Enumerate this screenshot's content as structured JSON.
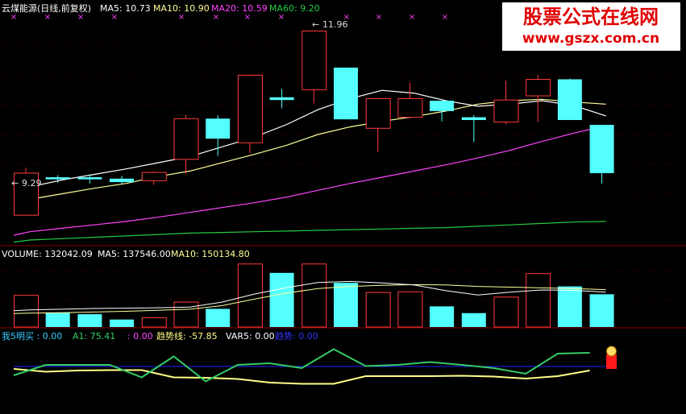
{
  "colors": {
    "up": "#ff3b3b",
    "down": "#54ffff",
    "ma5": "#ffffff",
    "ma10": "#ffff9a",
    "ma20": "#ff44ff",
    "ma60": "#22cc44",
    "divider": "#8a0000",
    "grid": "#4a0000",
    "axis_line": "#2222ff",
    "green_line": "#33cc66",
    "yellow_line": "#ffff88"
  },
  "main": {
    "title": "云煤能源(日线,前复权)",
    "ma5_label": "MA5: 10.73",
    "ma10_label": "MA10: 10.90",
    "ma20_label": "MA20: 10.59",
    "ma60_label": "MA60: 9.20",
    "high_label": "11.96",
    "low_label": "9.29"
  },
  "volume": {
    "label": "VOLUME: 132042.09",
    "ma5_label": "MA5: 137546.00",
    "ma10_label": "MA10: 150134.80"
  },
  "indicator": {
    "label1": "我5明买 : 0.00",
    "label2": "A1: 75.41",
    "label3": ": 0.00",
    "label4": "趋势线: -57.85",
    "label5": "VAR5: 0.00",
    "label6": "趋势: 0.00"
  },
  "watermark": {
    "line1": "股票公式在线网",
    "line2": "www.gszx.com.cn"
  },
  "chart_data": {
    "type": "candlestick",
    "price_range": [
      9.0,
      12.2
    ],
    "candles": [
      {
        "open": 9.29,
        "close": 9.9,
        "high": 9.98,
        "low": 9.29
      },
      {
        "open": 9.84,
        "close": 9.81,
        "high": 9.87,
        "low": 9.76
      },
      {
        "open": 9.84,
        "close": 9.81,
        "high": 9.88,
        "low": 9.75
      },
      {
        "open": 9.82,
        "close": 9.77,
        "high": 9.86,
        "low": 9.74
      },
      {
        "open": 9.79,
        "close": 9.91,
        "high": 9.93,
        "low": 9.73
      },
      {
        "open": 10.1,
        "close": 10.69,
        "high": 10.74,
        "low": 9.89
      },
      {
        "open": 10.69,
        "close": 10.4,
        "high": 10.74,
        "low": 10.15
      },
      {
        "open": 10.34,
        "close": 11.32,
        "high": 11.32,
        "low": 10.19
      },
      {
        "open": 11.0,
        "close": 10.96,
        "high": 11.12,
        "low": 10.84
      },
      {
        "open": 11.11,
        "close": 11.96,
        "high": 11.96,
        "low": 10.91
      },
      {
        "open": 11.43,
        "close": 10.68,
        "high": 11.43,
        "low": 10.68
      },
      {
        "open": 10.55,
        "close": 10.98,
        "high": 10.98,
        "low": 10.21
      },
      {
        "open": 10.71,
        "close": 10.98,
        "high": 11.21,
        "low": 10.69
      },
      {
        "open": 10.95,
        "close": 10.8,
        "high": 10.95,
        "low": 10.65
      },
      {
        "open": 10.71,
        "close": 10.67,
        "high": 10.74,
        "low": 10.35
      },
      {
        "open": 10.64,
        "close": 10.96,
        "high": 11.24,
        "low": 10.61
      },
      {
        "open": 11.02,
        "close": 11.26,
        "high": 11.32,
        "low": 10.64
      },
      {
        "open": 11.26,
        "close": 10.67,
        "high": 11.27,
        "low": 10.67
      },
      {
        "open": 10.6,
        "close": 9.9,
        "high": 10.6,
        "low": 9.75
      }
    ],
    "ma5": [
      9.6,
      9.7,
      9.8,
      9.88,
      9.96,
      10.05,
      10.14,
      10.28,
      10.42,
      10.6,
      10.82,
      10.98,
      11.1,
      11.06,
      10.95,
      10.87,
      10.9,
      10.95,
      10.88,
      10.73
    ],
    "ma10": [
      9.45,
      9.52,
      9.6,
      9.68,
      9.75,
      9.85,
      9.93,
      10.05,
      10.17,
      10.3,
      10.46,
      10.57,
      10.65,
      10.72,
      10.8,
      10.9,
      10.95,
      10.97,
      10.93,
      10.9
    ],
    "ma20": [
      9.0,
      9.05,
      9.1,
      9.15,
      9.2,
      9.26,
      9.33,
      9.4,
      9.47,
      9.55,
      9.65,
      9.75,
      9.84,
      9.93,
      10.02,
      10.12,
      10.23,
      10.36,
      10.48,
      10.59
    ],
    "ma60": [
      8.9,
      8.93,
      8.95,
      8.97,
      8.99,
      9.01,
      9.03,
      9.04,
      9.05,
      9.06,
      9.07,
      9.08,
      9.09,
      9.1,
      9.11,
      9.13,
      9.15,
      9.17,
      9.19,
      9.2
    ],
    "volume_range": [
      0,
      190000
    ],
    "volume": [
      89000,
      41000,
      36000,
      21000,
      26000,
      70000,
      51000,
      177000,
      152000,
      177000,
      124000,
      97000,
      99000,
      58000,
      39000,
      84000,
      150000,
      114000,
      92000
    ],
    "vol_ma5": [
      46000,
      48000,
      50000,
      52000,
      53000,
      54000,
      56000,
      70000,
      92000,
      110000,
      125000,
      128000,
      124000,
      118000,
      102000,
      90000,
      98000,
      104000,
      103000,
      98000
    ],
    "vol_ma10": [
      38000,
      39000,
      40000,
      42000,
      44000,
      47000,
      50000,
      60000,
      78000,
      95000,
      108000,
      114000,
      117000,
      119000,
      118000,
      114000,
      112000,
      110000,
      108000,
      105000
    ],
    "ind_range": [
      -110,
      60
    ],
    "ind_blue_level": 0,
    "ind_green": [
      -22,
      4,
      4,
      4,
      -27,
      25,
      -37,
      4,
      8,
      -4,
      43,
      1,
      4,
      11,
      4,
      -4,
      -18,
      32,
      34
    ],
    "ind_yellow": [
      -6,
      -13,
      -10,
      -9,
      -9,
      -27,
      -28,
      -31,
      -40,
      -43,
      -43,
      -24,
      -24,
      -24,
      -23,
      -25,
      -30,
      -24,
      -10
    ],
    "cross_markers_count": 13
  }
}
